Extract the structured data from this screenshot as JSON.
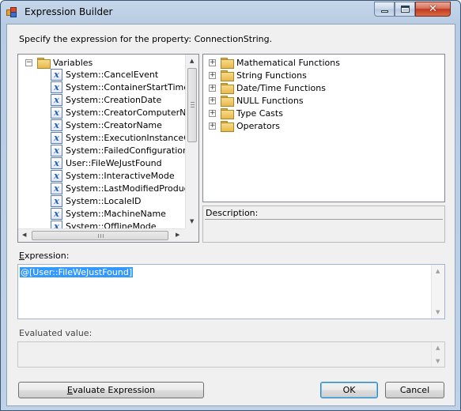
{
  "window": {
    "title": "Expression Builder"
  },
  "prompt": "Specify the expression for the property: ConnectionString.",
  "variables": {
    "root_label": "Variables",
    "items": [
      "System::CancelEvent",
      "System::ContainerStartTime",
      "System::CreationDate",
      "System::CreatorComputerName",
      "System::CreatorName",
      "System::ExecutionInstanceGUI",
      "System::FailedConfigurations",
      "User::FileWeJustFound",
      "System::InteractiveMode",
      "System::LastModifiedProductVe",
      "System::LocaleID",
      "System::MachineName",
      "System::OfflineMode"
    ]
  },
  "functions": {
    "items": [
      "Mathematical Functions",
      "String Functions",
      "Date/Time Functions",
      "NULL Functions",
      "Type Casts",
      "Operators"
    ]
  },
  "description_label": "Description:",
  "expression": {
    "label_mnemonic": "E",
    "label_rest": "xpression:",
    "value": "@[User::FileWeJustFound]"
  },
  "evaluated_label": "Evaluated value:",
  "buttons": {
    "evaluate_mnemonic": "E",
    "evaluate_rest": "valuate Expression",
    "ok": "OK",
    "cancel": "Cancel"
  },
  "icons": {
    "app": "expression-builder-icon",
    "folder": "folder-icon",
    "variable": "variable-icon"
  }
}
